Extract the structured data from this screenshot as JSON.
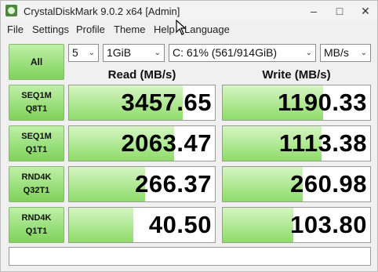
{
  "window": {
    "title": "CrystalDiskMark 9.0.2 x64 [Admin]"
  },
  "window_controls": {
    "minimize": "–",
    "maximize": "□",
    "close": "✕"
  },
  "menu": {
    "file": "File",
    "settings": "Settings",
    "profile": "Profile",
    "theme": "Theme",
    "help": "Help",
    "language": "Language"
  },
  "controls": {
    "all_label": "All",
    "count": "5",
    "size": "1GiB",
    "drive": "C: 61% (561/914GiB)",
    "unit": "MB/s"
  },
  "headers": {
    "read": "Read (MB/s)",
    "write": "Write (MB/s)"
  },
  "tests": [
    {
      "line1": "SEQ1M",
      "line2": "Q8T1",
      "read": "3457.65",
      "write": "1190.33"
    },
    {
      "line1": "SEQ1M",
      "line2": "Q1T1",
      "read": "2063.47",
      "write": "1113.38"
    },
    {
      "line1": "RND4K",
      "line2": "Q32T1",
      "read": "266.37",
      "write": "260.98"
    },
    {
      "line1": "RND4K",
      "line2": "Q1T1",
      "read": "40.50",
      "write": "103.80"
    }
  ],
  "status_text": ""
}
